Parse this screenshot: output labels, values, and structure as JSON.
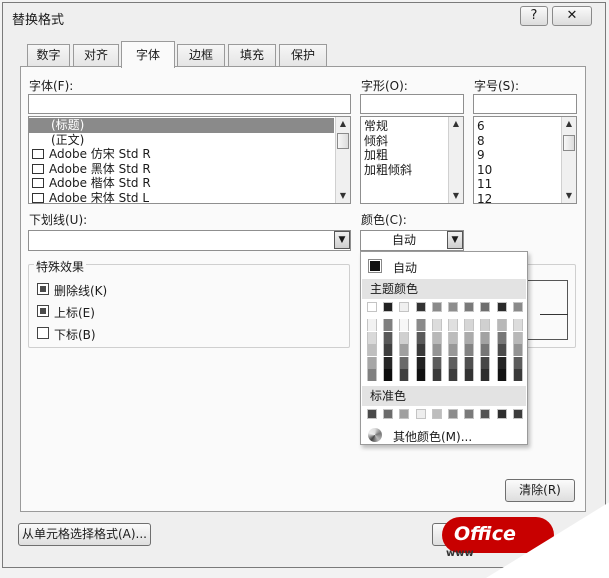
{
  "window": {
    "title": "替换格式",
    "help_label": "?",
    "close_label": "✕"
  },
  "tabs": [
    {
      "label": "数字"
    },
    {
      "label": "对齐"
    },
    {
      "label": "字体"
    },
    {
      "label": "边框"
    },
    {
      "label": "填充"
    },
    {
      "label": "保护"
    }
  ],
  "active_tab": "字体",
  "font": {
    "label": "字体(F):",
    "value": "",
    "items": [
      "(标题)",
      "(正文)",
      "Adobe 仿宋 Std R",
      "Adobe 黑体 Std R",
      "Adobe 楷体 Std R",
      "Adobe 宋体 Std L"
    ],
    "selected_index": 0
  },
  "style": {
    "label": "字形(O):",
    "value": "",
    "items": [
      "常规",
      "倾斜",
      "加粗",
      "加粗倾斜"
    ]
  },
  "size": {
    "label": "字号(S):",
    "value": "",
    "items": [
      "6",
      "8",
      "9",
      "10",
      "11",
      "12"
    ]
  },
  "underline": {
    "label": "下划线(U):",
    "value": ""
  },
  "color": {
    "label": "颜色(C):",
    "value": "自动"
  },
  "effects": {
    "title": "特殊效果",
    "strikethrough": {
      "label": "删除线(K)",
      "checked": true
    },
    "superscript": {
      "label": "上标(E)",
      "checked": true
    },
    "subscript": {
      "label": "下标(B)",
      "checked": false
    }
  },
  "color_popup": {
    "auto_label": "自动",
    "theme_title": "主题颜色",
    "theme_top": [
      "#ffffff",
      "#222222",
      "#f0f0f0",
      "#333333",
      "#8a8a8a",
      "#8e8e8e",
      "#7a7a7a",
      "#6e6e6e",
      "#2a2a2a",
      "#8a8a8a"
    ],
    "theme_shades": [
      [
        "#f2f2f2",
        "#d9d9d9",
        "#bfbfbf",
        "#a6a6a6",
        "#808080"
      ],
      [
        "#7f7f7f",
        "#595959",
        "#3f3f3f",
        "#262626",
        "#0d0d0d"
      ],
      [
        "#f7f7f7",
        "#d0d0d0",
        "#a0a0a0",
        "#6a6a6a",
        "#404040"
      ],
      [
        "#8a8a8a",
        "#5a5a5a",
        "#3a3a3a",
        "#222222",
        "#111111"
      ],
      [
        "#dcdcdc",
        "#b8b8b8",
        "#949494",
        "#5c5c5c",
        "#3a3a3a"
      ],
      [
        "#e0e0e0",
        "#bcbcbc",
        "#989898",
        "#5e5e5e",
        "#3c3c3c"
      ],
      [
        "#d6d6d6",
        "#ababab",
        "#838383",
        "#505050",
        "#333333"
      ],
      [
        "#d0d0d0",
        "#a2a2a2",
        "#777777",
        "#474747",
        "#2c2c2c"
      ],
      [
        "#b8b8b8",
        "#777777",
        "#4c4c4c",
        "#242424",
        "#121212"
      ],
      [
        "#dcdcdc",
        "#b8b8b8",
        "#949494",
        "#5c5c5c",
        "#3a3a3a"
      ]
    ],
    "standard_title": "标准色",
    "standard": [
      "#4a4a4a",
      "#6b6b6b",
      "#a0a0a0",
      "#eeeeee",
      "#bdbdbd",
      "#8c8c8c",
      "#7a7a7a",
      "#545454",
      "#2e2e2e",
      "#3c3c3c"
    ],
    "more_label": "其他颜色(M)..."
  },
  "buttons": {
    "clear": "清除(R)",
    "pick_from_cell": "从单元格选择格式(A)..."
  },
  "watermark": {
    "logo_text": "Office",
    "url_text": "www"
  }
}
